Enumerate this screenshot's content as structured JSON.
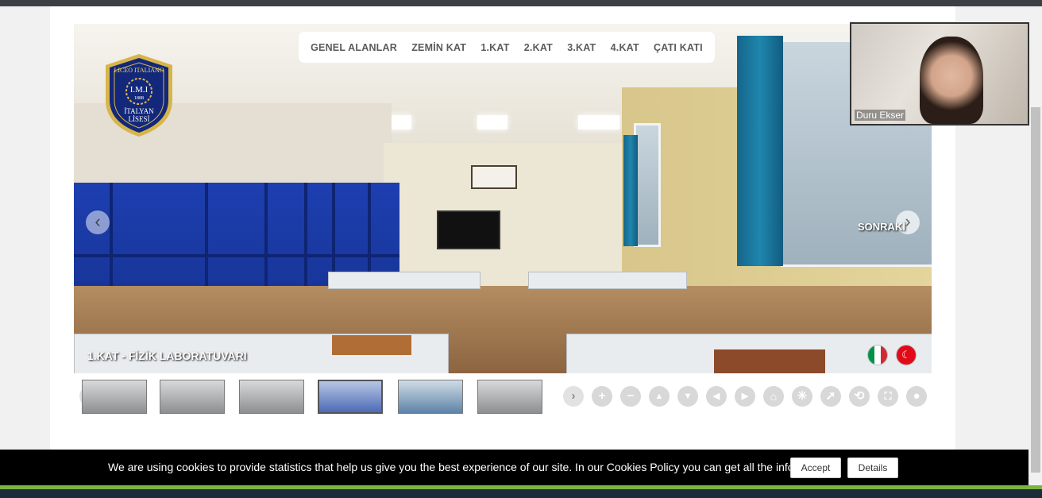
{
  "nav": {
    "items": [
      "GENEL ALANLAR",
      "ZEMİN KAT",
      "1.KAT",
      "2.KAT",
      "3.KAT",
      "4.KAT",
      "ÇATI KATI"
    ]
  },
  "logo": {
    "line1": "LICEO ITALIANO",
    "line2": "I.M.I",
    "line3": "1888",
    "line4": "İTALYAN",
    "line5": "LİSESİ"
  },
  "scene": {
    "title": "1.KAT - FİZİK LABORATUVARI",
    "next_label": "SONRAKİ"
  },
  "video": {
    "participant": "Duru Ekser"
  },
  "thumbnails": {
    "count": 6,
    "selected_index": 3
  },
  "toolbar": {
    "icons": [
      "zoom-in-icon",
      "zoom-out-icon",
      "arrow-up-icon",
      "arrow-down-icon",
      "arrow-left-icon",
      "arrow-right-icon",
      "home-icon",
      "autorotate-icon",
      "gyro-icon",
      "vr-icon",
      "fullscreen-icon",
      "info-icon"
    ]
  },
  "cookie": {
    "text": "We are using cookies to provide statistics that help us give you the best experience of our site. In our Cookies Policy you can get all the information.",
    "accept": "Accept",
    "details": "Details"
  },
  "colors": {
    "cabinet_blue": "#1d3fb0",
    "curtain_teal": "#1f86ad",
    "logo_navy": "#13287a",
    "logo_gold": "#d8b54a"
  }
}
